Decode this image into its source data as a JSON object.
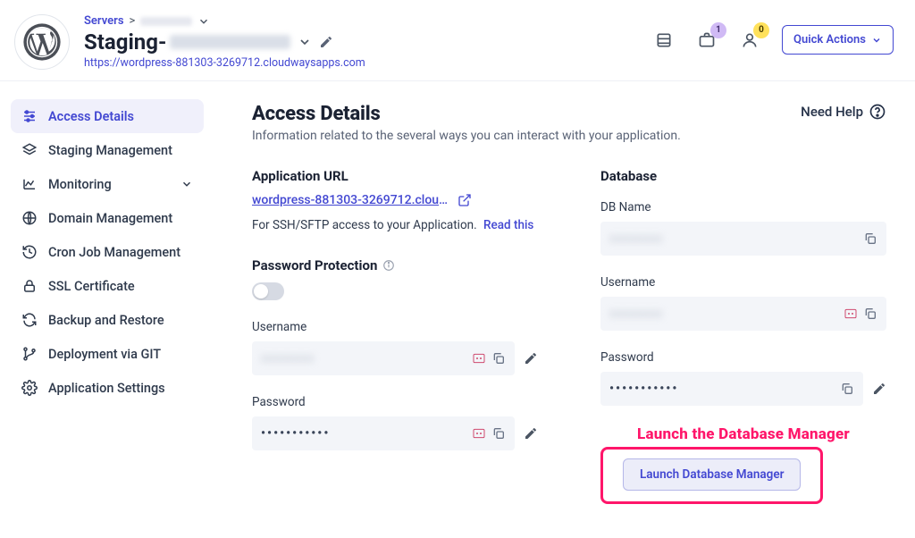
{
  "breadcrumb": {
    "root_label": "Servers",
    "sep": ">"
  },
  "header": {
    "title_prefix": "Staging-",
    "url": "https://wordpress-881303-3269712.cloudwaysapps.com",
    "badges": {
      "purple_count": "1",
      "yellow_count": "0"
    },
    "quick_actions_label": "Quick Actions"
  },
  "sidebar": {
    "items": [
      {
        "label": "Access Details"
      },
      {
        "label": "Staging Management"
      },
      {
        "label": "Monitoring"
      },
      {
        "label": "Domain Management"
      },
      {
        "label": "Cron Job Management"
      },
      {
        "label": "SSL Certificate"
      },
      {
        "label": "Backup and Restore"
      },
      {
        "label": "Deployment via GIT"
      },
      {
        "label": "Application Settings"
      }
    ]
  },
  "page": {
    "heading": "Access Details",
    "sub": "Information related to the several ways you can interact with your application.",
    "need_help": "Need Help"
  },
  "appurl": {
    "section": "Application URL",
    "link": "wordpress-881303-3269712.cloudwa…",
    "caption_prefix": "For SSH/SFTP access to your Application.",
    "read_link": "Read this"
  },
  "passprot": {
    "section": "Password Protection",
    "username_label": "Username",
    "password_label": "Password",
    "password_value": "•••••••••••"
  },
  "database": {
    "section": "Database",
    "dbname_label": "DB Name",
    "username_label": "Username",
    "password_label": "Password",
    "password_value": "•••••••••••",
    "callout": "Launch the Database Manager",
    "launch_label": "Launch Database Manager"
  }
}
